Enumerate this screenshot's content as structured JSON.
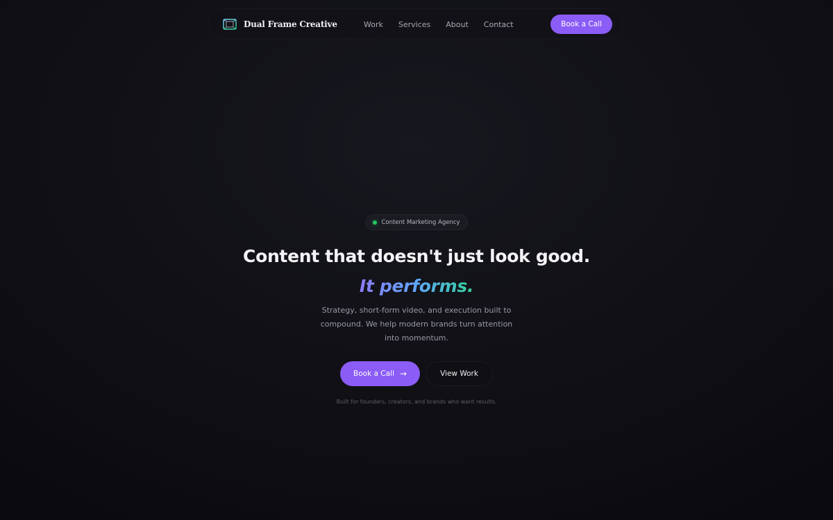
{
  "nav": {
    "brand_name": "Dual Frame Creative",
    "brand_icon": "frame-logo-icon",
    "links": [
      "Work",
      "Services",
      "About",
      "Contact"
    ],
    "cta_label": "Book a Call"
  },
  "hero": {
    "badge_text": "Content Marketing Agency",
    "badge_dot_color": "#22c55e",
    "headline": "Content that doesn't just look good.",
    "tagline": "It performs.",
    "subtext": "Strategy, short-form video, and execution built to compound. We help modern brands turn attention into momentum.",
    "primary_button": "Book a Call",
    "primary_button_icon": "arrow-right-icon",
    "secondary_button": "View Work",
    "footnote": "Built for founders, creators, and brands who want results."
  },
  "colors": {
    "accent": "#8b5cf6",
    "background": "#111117",
    "gradient_start": "#8b7cf6",
    "gradient_mid": "#60a5fa",
    "gradient_end": "#34d399"
  }
}
